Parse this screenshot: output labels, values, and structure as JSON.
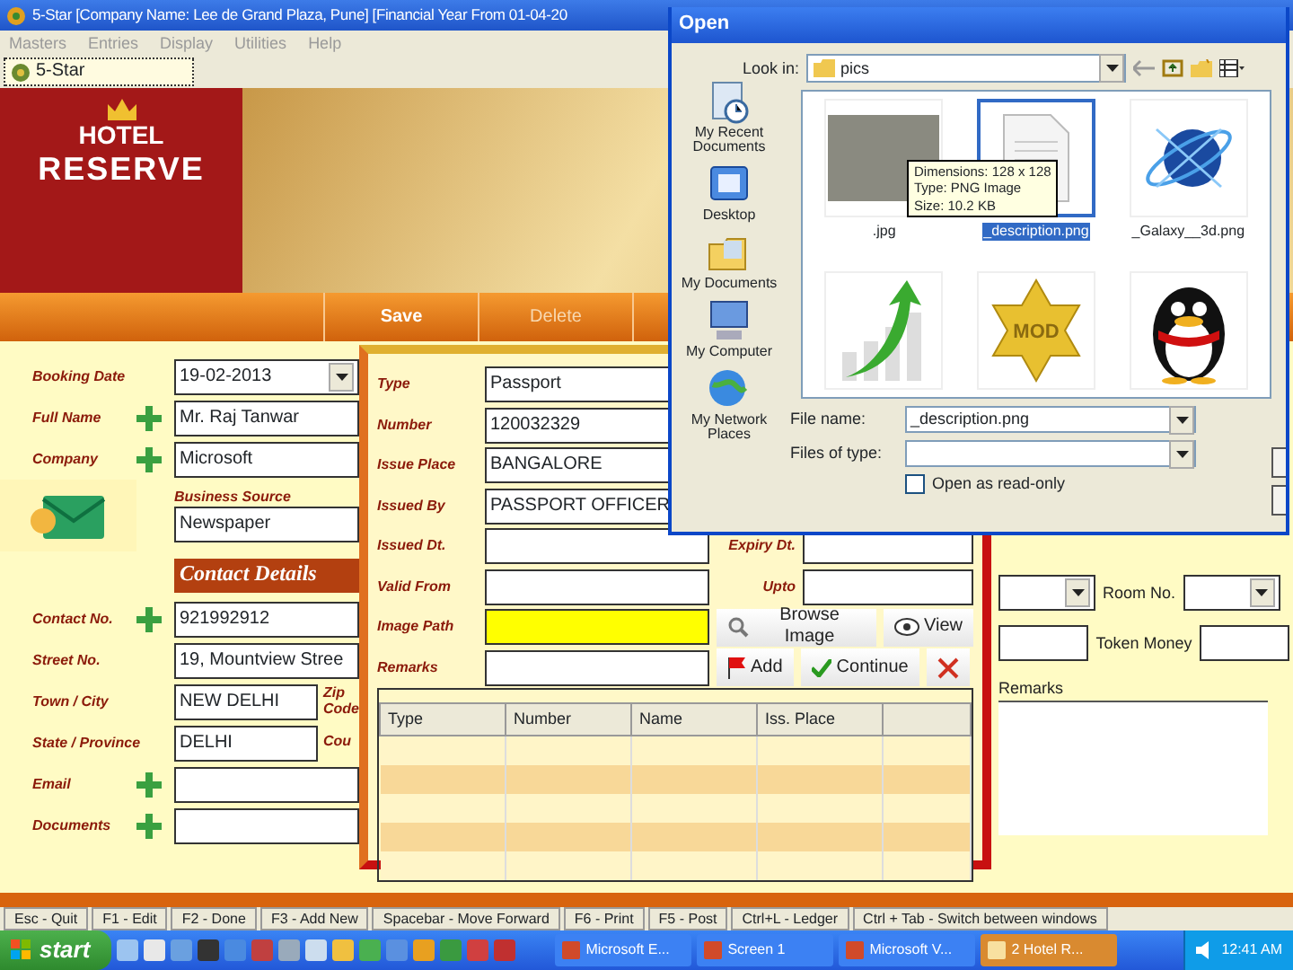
{
  "window": {
    "title": "5-Star [Company Name: Lee de Grand Plaza, Pune] [Financial Year From 01-04-20"
  },
  "menu": [
    "Masters",
    "Entries",
    "Display",
    "Utilities",
    "Help"
  ],
  "tabs": [
    {
      "label": "5-Star",
      "selected": true
    }
  ],
  "logo": {
    "line1": "HOTEL",
    "line2": "RESERVE"
  },
  "toolbar": [
    {
      "label": "Save",
      "disabled": false
    },
    {
      "label": "Delete",
      "disabled": true
    }
  ],
  "booking": {
    "rows": [
      {
        "label": "Booking Date",
        "value": "19-02-2013",
        "kind": "date"
      },
      {
        "label": "Full Name",
        "value": "Mr. Raj Tanwar",
        "kind": "add"
      },
      {
        "label": "Company",
        "value": "Microsoft",
        "kind": "add"
      },
      {
        "label": "Business Source",
        "value": "Newspaper",
        "kind": "source"
      }
    ]
  },
  "contact": {
    "heading": "Contact Details",
    "rows": [
      {
        "label": "Contact No.",
        "value": "921992912",
        "kind": "add"
      },
      {
        "label": "Street No.",
        "value": "19, Mountview Stree",
        "kind": "text"
      },
      {
        "label": "Town / City",
        "value": "NEW DELHI",
        "kind": "short",
        "side_label": "Zip Code"
      },
      {
        "label": "State / Province",
        "value": "DELHI",
        "kind": "short",
        "side_label": "Cou"
      },
      {
        "label": "Email",
        "kind": "add"
      },
      {
        "label": "Documents",
        "kind": "add"
      }
    ]
  },
  "room": {
    "fields": [
      {
        "kind": "dropdown"
      },
      {
        "label": "Room No.",
        "kind": "dropdown"
      },
      {
        "kind": "text"
      },
      {
        "label": "Token Money",
        "kind": "text"
      }
    ],
    "remarks_label": "Remarks"
  },
  "document_dialog": {
    "fields": [
      {
        "label": "Type",
        "value": "Passport",
        "highlighted": false
      },
      {
        "label": "Number",
        "value": "120032329",
        "highlighted": false
      },
      {
        "label": "Issue Place",
        "value": "BANGALORE",
        "highlighted": false
      },
      {
        "label": "Issued By",
        "value": "PASSPORT OFFICER",
        "highlighted": false
      },
      {
        "label": "Issued Dt.",
        "highlighted": false
      },
      {
        "label": "Valid From",
        "highlighted": false
      },
      {
        "label": "Image Path",
        "highlighted": true
      },
      {
        "label": "Remarks",
        "highlighted": false
      }
    ],
    "right_fields": [
      {
        "label": "Expiry Dt."
      },
      {
        "label": "Upto"
      }
    ],
    "buttons": [
      {
        "label": "Browse Image",
        "kind": "browse"
      },
      {
        "label": "View",
        "kind": "view"
      },
      {
        "label": "Add",
        "kind": "add"
      },
      {
        "label": "Continue",
        "kind": "continue"
      },
      {
        "kind": "close"
      }
    ],
    "grid": {
      "columns": [
        "Type",
        "Number",
        "Name",
        "Iss. Place"
      ]
    }
  },
  "open_dialog": {
    "title": "Open",
    "look_in_label": "Look in:",
    "look_in": "pics",
    "places": [
      {
        "label": "My Recent Documents",
        "kind": "recent"
      },
      {
        "label": "Desktop",
        "kind": "desktop"
      },
      {
        "label": "My Documents",
        "kind": "documents"
      },
      {
        "label": "My Computer",
        "kind": "computer"
      },
      {
        "label": "My Network Places",
        "kind": "network"
      }
    ],
    "files": [
      {
        "name": ".jpg",
        "kind": "photo",
        "selected": false
      },
      {
        "name": "_description.png",
        "kind": "document",
        "selected": true
      },
      {
        "name": "_Galaxy__3d.png",
        "kind": "globe",
        "selected": false
      },
      {
        "kind": "chart",
        "selected": false
      },
      {
        "kind": "badge",
        "badge_text": "MOD",
        "selected": false
      },
      {
        "kind": "penguin",
        "selected": false
      }
    ],
    "tooltip": [
      "Dimensions: 128 x 128",
      "Type: PNG Image",
      "Size: 10.2 KB"
    ],
    "file_name_label": "File name:",
    "file_name": "_description.png",
    "file_type_label": "Files of type:",
    "read_only": {
      "label": "Open as read-only",
      "checked": false
    }
  },
  "status_bar": [
    "Esc - Quit",
    "F1 - Edit",
    "F2 - Done",
    "F3 - Add New",
    "Spacebar - Move Forward",
    "F6 - Print",
    "F5 - Post",
    "Ctrl+L - Ledger",
    "Ctrl + Tab - Switch between windows"
  ],
  "taskbar": {
    "start": "start",
    "tasks": [
      {
        "label": "Microsoft E...",
        "selected": false
      },
      {
        "label": "Screen 1",
        "selected": false
      },
      {
        "label": "Microsoft V...",
        "selected": false
      },
      {
        "label": "2 Hotel R...",
        "selected": true
      }
    ],
    "clock": "12:41 AM"
  }
}
